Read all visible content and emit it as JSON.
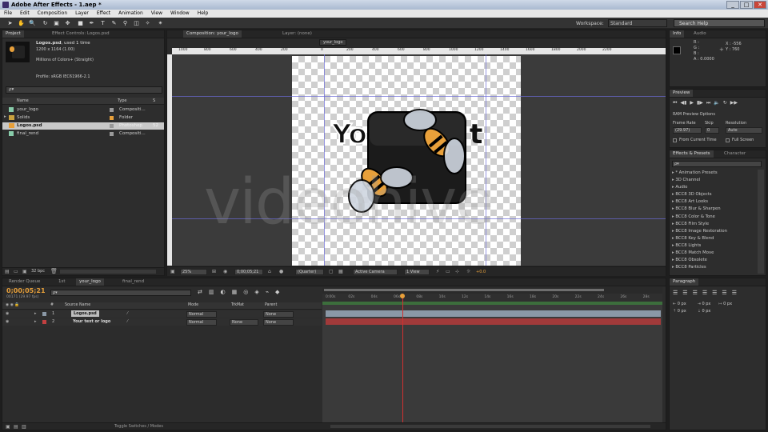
{
  "window": {
    "title": "Adobe After Effects - 1.aep *",
    "buttons": [
      "_",
      "□",
      "✕"
    ]
  },
  "menu": [
    "File",
    "Edit",
    "Composition",
    "Layer",
    "Effect",
    "Animation",
    "View",
    "Window",
    "Help"
  ],
  "toolbar": {
    "workspace_label": "Workspace:",
    "workspace_value": "Standard",
    "search_placeholder": "Search Help"
  },
  "project": {
    "tab": "Project",
    "tab2": "Effect Controls: Logos.psd",
    "asset_name": "Logos.psd",
    "asset_used": ", used 1 time",
    "asset_dims": "1200 x 1164 (1.00)",
    "asset_colors": "Millions of Colors+ (Straight)",
    "asset_profile": "Profile: sRGB IEC61966-2.1",
    "search_placeholder": "ρ▾",
    "columns": {
      "name": "Name",
      "type": "Type",
      "size": "S"
    },
    "items": [
      {
        "name": "your_logo",
        "type": "Compositi...",
        "size": "",
        "kind": "comp"
      },
      {
        "name": "Solids",
        "type": "Folder",
        "size": "",
        "kind": "folder"
      },
      {
        "name": "Logos.psd",
        "type": "Photoshop",
        "size": "52",
        "kind": "psd"
      },
      {
        "name": "final_rend",
        "type": "Compositi...",
        "size": "",
        "kind": "comp"
      }
    ],
    "bpc": "32 bpc"
  },
  "composition": {
    "tab": "Composition: your_logo",
    "tab2": "Layer: (none)",
    "breadcrumb": "your_logo",
    "ruler_top": [
      "1000",
      "800",
      "600",
      "400",
      "200",
      "0",
      "200",
      "400",
      "600",
      "800",
      "1000",
      "1200",
      "1400",
      "1600",
      "1800",
      "2000",
      "2200"
    ],
    "ruler_left": [
      "200",
      "0",
      "200",
      "400",
      "600",
      "800",
      "1000",
      "1200",
      "1400"
    ],
    "logo_text_left": "Yo",
    "logo_text_right": "t",
    "watermark": "videohive",
    "zoom": "25%",
    "timecode": "0;00;05;21",
    "resolution": "(Quarter)",
    "camera": "Active Camera",
    "views": "1 View",
    "exposure": "+0.0"
  },
  "info": {
    "tab": "Info",
    "tab2": "Audio",
    "r": "R :",
    "g": "G :",
    "b": "B :",
    "a": "A : 0.0000",
    "x": "X : -556",
    "y": "Y : 760"
  },
  "preview": {
    "tab": "Preview",
    "ram": "RAM Preview Options",
    "frame_rate_label": "Frame Rate",
    "frame_rate": "(29.97)",
    "skip_label": "Skip",
    "skip": "0",
    "resolution_label": "Resolution",
    "resolution": "Auto",
    "from_current": "From Current Time",
    "full_screen": "Full Screen"
  },
  "effects": {
    "tab": "Effects & Presets",
    "tab2": "Character",
    "search_placeholder": "ρ▾",
    "items": [
      "* Animation Presets",
      "3D Channel",
      "Audio",
      "BCC8 3D Objects",
      "BCC8 Art Looks",
      "BCC8 Blur & Sharpen",
      "BCC8 Color & Tone",
      "BCC8 Film Style",
      "BCC8 Image Restoration",
      "BCC8 Key & Blend",
      "BCC8 Lights",
      "BCC8 Match Move",
      "BCC8 Obsolete",
      "BCC8 Particles"
    ]
  },
  "timeline": {
    "tabs": [
      "Render Queue",
      "1st",
      "your_logo",
      "final_rend"
    ],
    "timecode": "0;00;05;21",
    "fps": "00171 (29.97 fps)",
    "search_placeholder": "ρ▾",
    "columns": {
      "num": "#",
      "source": "Source Name",
      "mode": "Mode",
      "trkmat": "TrkMat",
      "parent": "Parent"
    },
    "layers": [
      {
        "num": "1",
        "name": "Logos.psd",
        "mode": "Normal",
        "trkmat": "",
        "parent": "None",
        "bar_color": "#8a98a6"
      },
      {
        "num": "2",
        "name": "Your text or logo",
        "mode": "Normal",
        "trkmat": "None",
        "parent": "None",
        "bar_color": "#a13a3a"
      }
    ],
    "ticks": [
      "0:00s",
      "02s",
      "04s",
      "06s",
      "08s",
      "10s",
      "12s",
      "14s",
      "16s",
      "18s",
      "20s",
      "22s",
      "24s",
      "26s",
      "28s"
    ],
    "playhead_fraction": 0.235,
    "toggle_label": "Toggle Switches / Modes"
  },
  "paragraph": {
    "tab": "Paragraph",
    "px": [
      "0 px",
      "0 px",
      "0 px",
      "0 px",
      "0 px"
    ]
  },
  "colors": {
    "accent": "#e8a03a",
    "timecode": "#e8a03a",
    "guide": "#6b6bd6",
    "playhead": "#d03030"
  }
}
